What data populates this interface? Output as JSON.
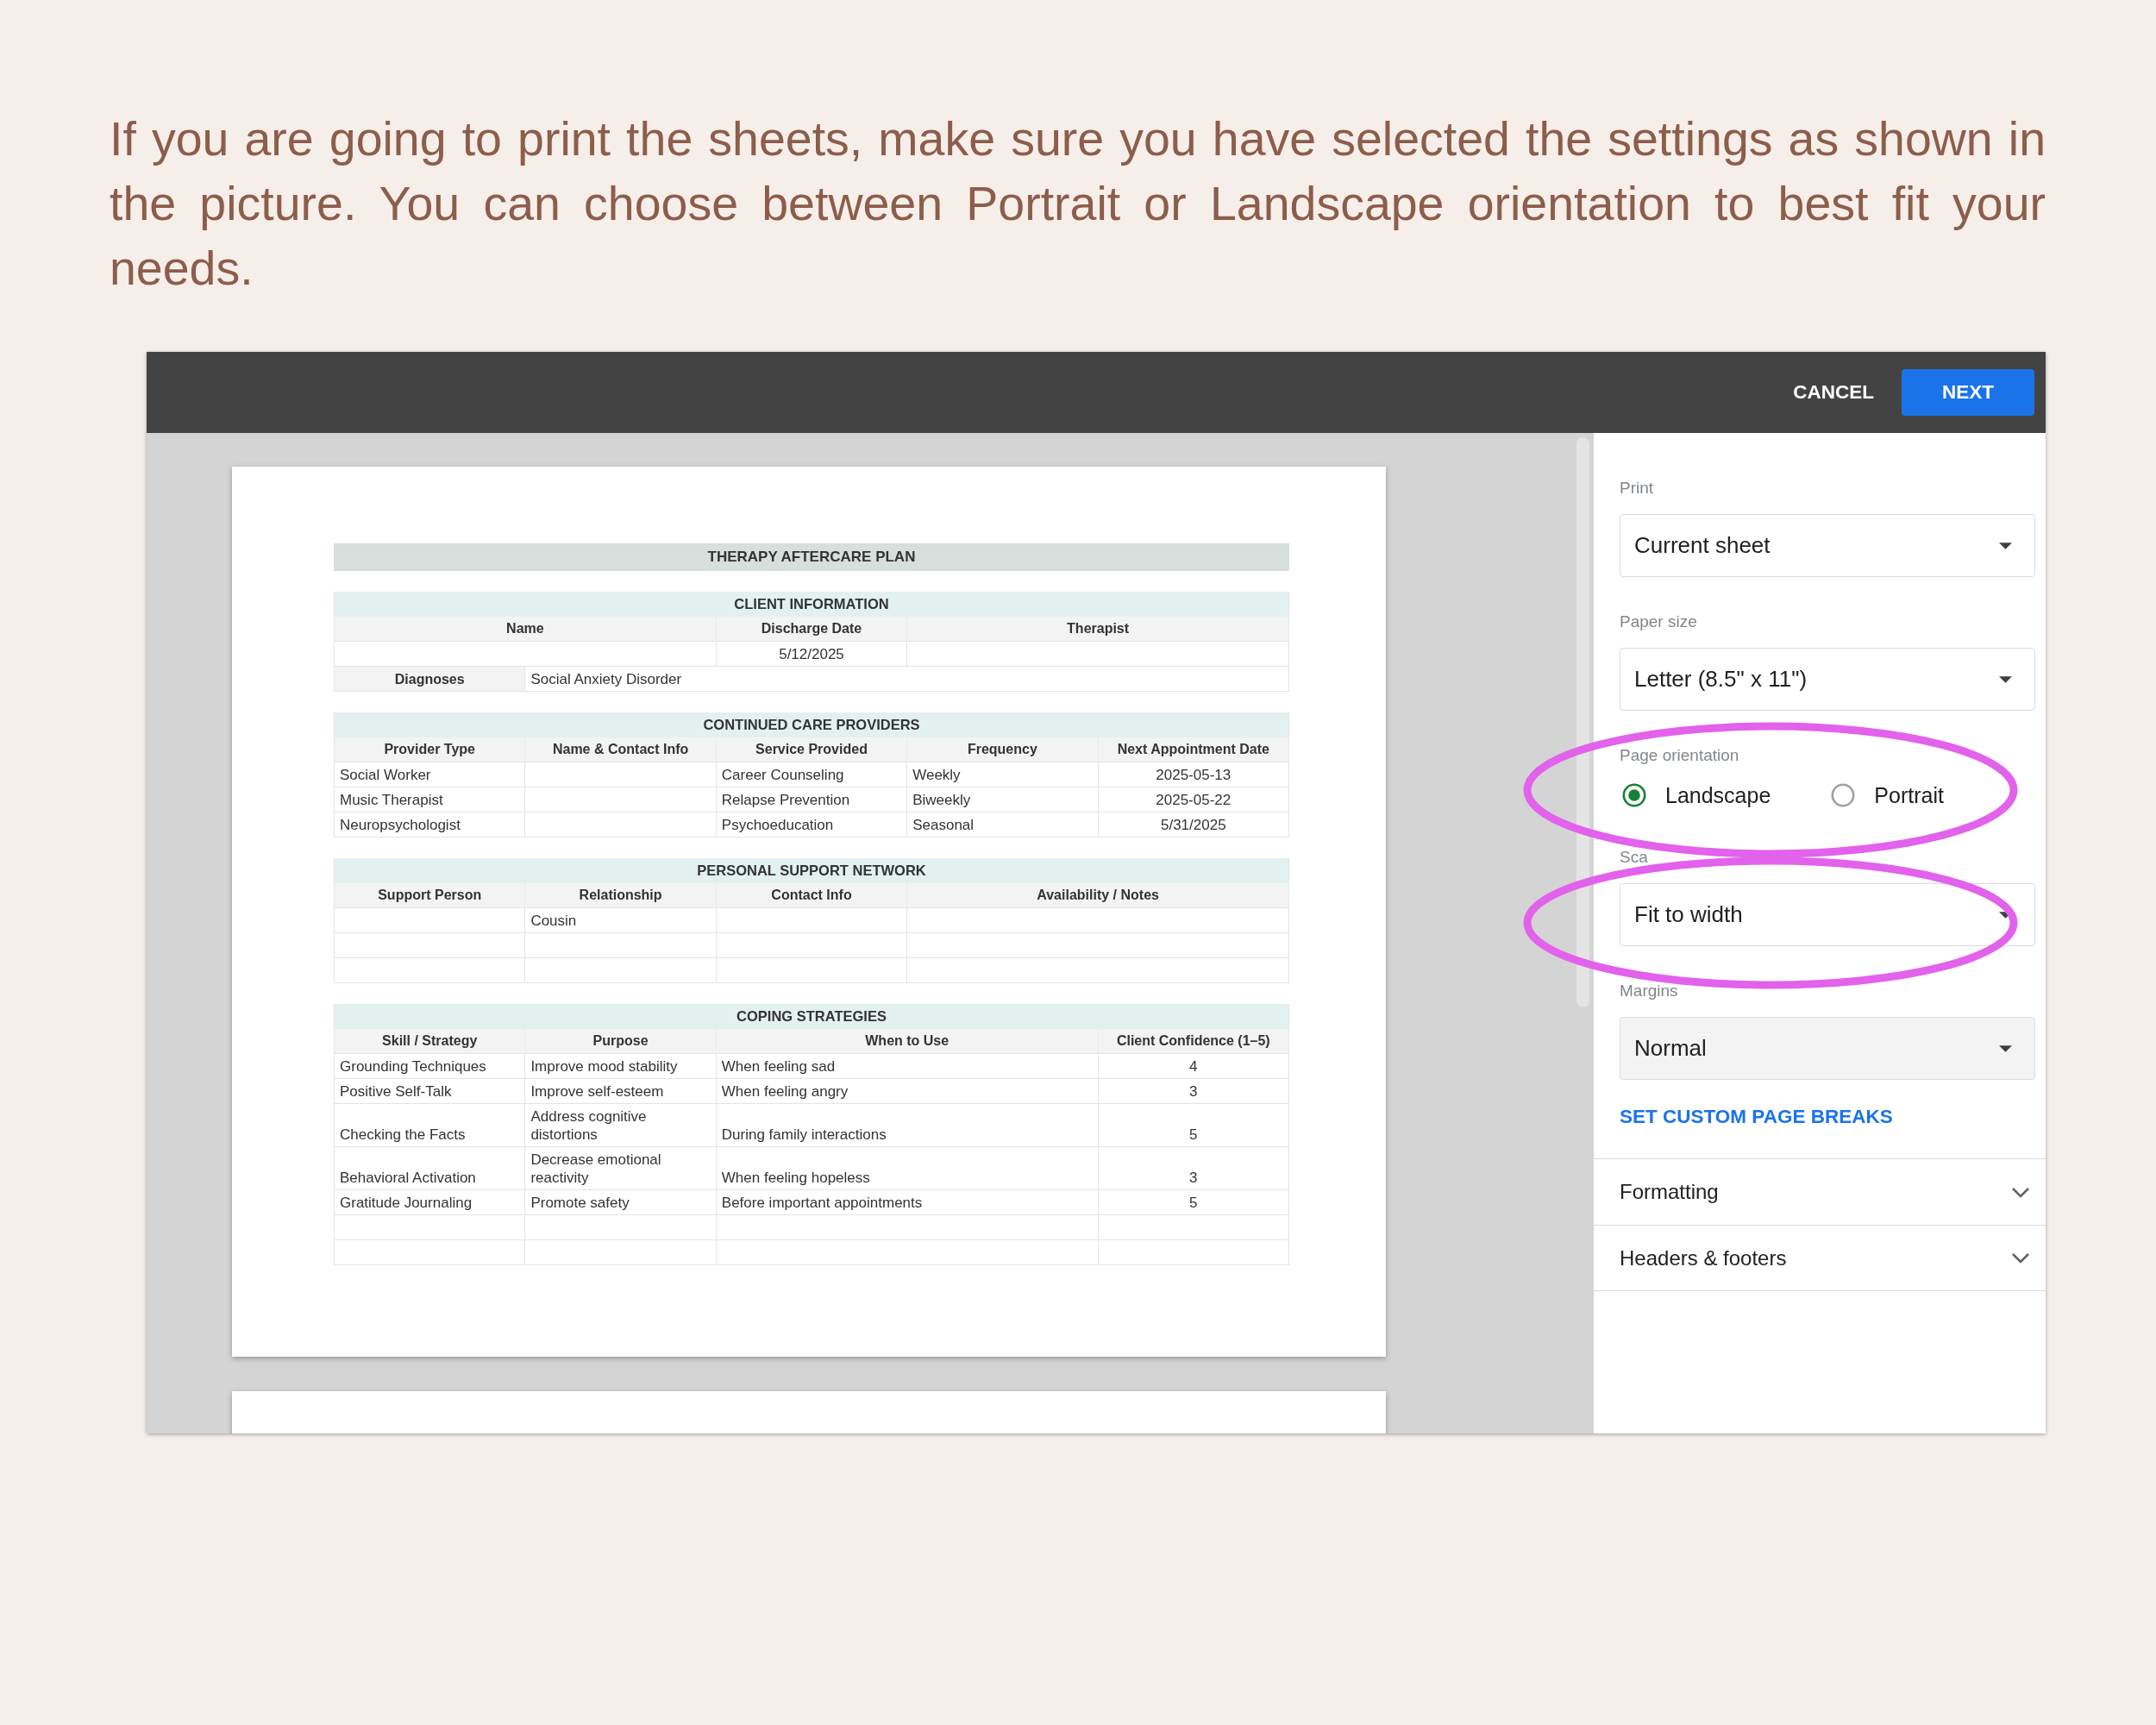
{
  "intro": {
    "text": "If you are going to print the sheets, make sure you have selected the settings as shown in the picture. You can choose between Portrait or Landscape orientation to best fit your needs."
  },
  "toolbar": {
    "buttons": [
      {
        "label": "CANCEL",
        "kind": "cancel"
      },
      {
        "label": "NEXT",
        "kind": "confirm"
      }
    ]
  },
  "preview": {
    "document": {
      "title": "THERAPY AFTERCARE PLAN",
      "sections": [
        {
          "kind": "client",
          "title": "CLIENT INFORMATION",
          "columns": [
            "Name",
            "Discharge Date",
            "Therapist"
          ],
          "rows": [
            [
              null,
              "5/12/2025",
              null
            ]
          ],
          "diagnoses": {
            "label": "Diagnoses",
            "value": "Social Anxiety Disorder"
          }
        },
        {
          "kind": "providers",
          "title": "CONTINUED CARE PROVIDERS",
          "columns": [
            "Provider Type",
            "Name & Contact Info",
            "Service Provided",
            "Frequency",
            "Next Appointment Date"
          ],
          "rows": [
            [
              "Social Worker",
              null,
              "Career Counseling",
              "Weekly",
              "2025-05-13"
            ],
            [
              "Music Therapist",
              null,
              "Relapse Prevention",
              "Biweekly",
              "2025-05-22"
            ],
            [
              "Neuropsychologist",
              null,
              "Psychoeducation",
              "Seasonal",
              "5/31/2025"
            ]
          ]
        },
        {
          "kind": "support",
          "title": "PERSONAL SUPPORT NETWORK",
          "columns": [
            "Support Person",
            "Relationship",
            "Contact Info",
            "Availability / Notes"
          ],
          "rows": [
            [
              null,
              "Cousin",
              null,
              null
            ],
            [
              null,
              null,
              null,
              null
            ],
            [
              null,
              null,
              null,
              null
            ]
          ]
        },
        {
          "kind": "coping",
          "title": "COPING STRATEGIES",
          "columns": [
            "Skill / Strategy",
            "Purpose",
            "When to Use",
            "Client Confidence (1–5)"
          ],
          "rows": [
            [
              "Grounding Techniques",
              "Improve mood stability",
              "When feeling sad",
              "4"
            ],
            [
              "Positive Self-Talk",
              "Improve self-esteem",
              "When feeling angry",
              "3"
            ],
            [
              "Checking the Facts",
              "Address cognitive distortions",
              "During family interactions",
              "5"
            ],
            [
              "Behavioral Activation",
              "Decrease emotional reactivity",
              "When feeling hopeless",
              "3"
            ],
            [
              "Gratitude Journaling",
              "Promote safety",
              "Before important appointments",
              "5"
            ],
            [
              null,
              null,
              null,
              null
            ],
            [
              null,
              null,
              null,
              null
            ]
          ]
        }
      ]
    }
  },
  "settings": {
    "fields": [
      {
        "kind": "select",
        "label": "Print",
        "value": "Current sheet",
        "highlighted": false
      },
      {
        "kind": "select",
        "label": "Paper size",
        "value": "Letter (8.5\" x 11\")",
        "highlighted": false
      },
      {
        "kind": "radio",
        "label": "Page orientation",
        "options": [
          {
            "label": "Landscape",
            "selected": true
          },
          {
            "label": "Portrait",
            "selected": false
          }
        ],
        "highlighted": true
      },
      {
        "kind": "select",
        "label": "Sca",
        "value": "Fit to width",
        "highlighted": true
      },
      {
        "kind": "select_filled",
        "label": "Margins",
        "value": "Normal",
        "highlighted": false
      }
    ],
    "link": "SET CUSTOM PAGE BREAKS",
    "sections": [
      {
        "label": "Formatting",
        "expanded": false
      },
      {
        "label": "Headers & footers",
        "expanded": false
      }
    ]
  }
}
